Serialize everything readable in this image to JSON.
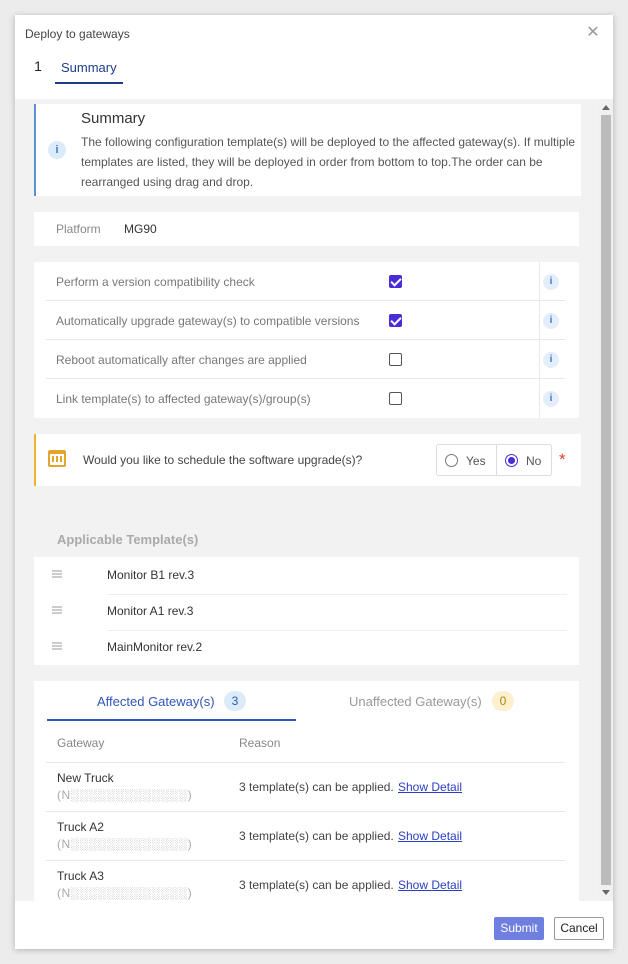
{
  "dialog": {
    "title": "Deploy to gateways",
    "close_icon": "close-icon"
  },
  "steps": [
    {
      "number": "1",
      "label": "Summary"
    }
  ],
  "summary": {
    "title": "Summary",
    "body": "The following configuration template(s) will be deployed to the affected gateway(s). If multiple templates are listed, they will be deployed in order from bottom to top.The order can be rearranged using drag and drop.",
    "icon": "info-icon"
  },
  "platform": {
    "label": "Platform",
    "value": "MG90"
  },
  "options": [
    {
      "label": "Perform a version compatibility check",
      "checked": true
    },
    {
      "label": "Automatically upgrade gateway(s) to compatible versions",
      "checked": true
    },
    {
      "label": "Reboot automatically after changes are applied",
      "checked": false
    },
    {
      "label": "Link template(s) to affected gateway(s)/group(s)",
      "checked": false
    }
  ],
  "schedule": {
    "question": "Would you like to schedule the software upgrade(s)?",
    "yes_label": "Yes",
    "no_label": "No",
    "selected": "No",
    "required_mark": "*",
    "icon": "calendar-icon"
  },
  "templates": {
    "heading": "Applicable Template(s)",
    "items": [
      "Monitor B1 rev.3",
      "Monitor A1 rev.3",
      "MainMonitor rev.2"
    ]
  },
  "gateways": {
    "tabs": [
      {
        "label": "Affected Gateway(s)",
        "count": "3"
      },
      {
        "label": "Unaffected Gateway(s)",
        "count": "0"
      }
    ],
    "columns": [
      "Gateway",
      "Reason"
    ],
    "rows": [
      {
        "name": "New Truck",
        "id": "(N░░░░░░░░░░░░░)",
        "reason": "3 template(s) can be applied.",
        "link": "Show Detail"
      },
      {
        "name": "Truck A2",
        "id": "(N░░░░░░░░░░░░░)",
        "reason": "3 template(s) can be applied.",
        "link": "Show Detail"
      },
      {
        "name": "Truck A3",
        "id": "(N░░░░░░░░░░░░░)",
        "reason": "3 template(s) can be applied.",
        "link": "Show Detail"
      }
    ]
  },
  "footer": {
    "submit_label": "Submit",
    "cancel_label": "Cancel"
  },
  "colors": {
    "accent": "#2f56b8",
    "checkbox": "#4b2bd6",
    "submit": "#6f7fe0",
    "warning": "#f0b429",
    "required": "#e0443a"
  }
}
